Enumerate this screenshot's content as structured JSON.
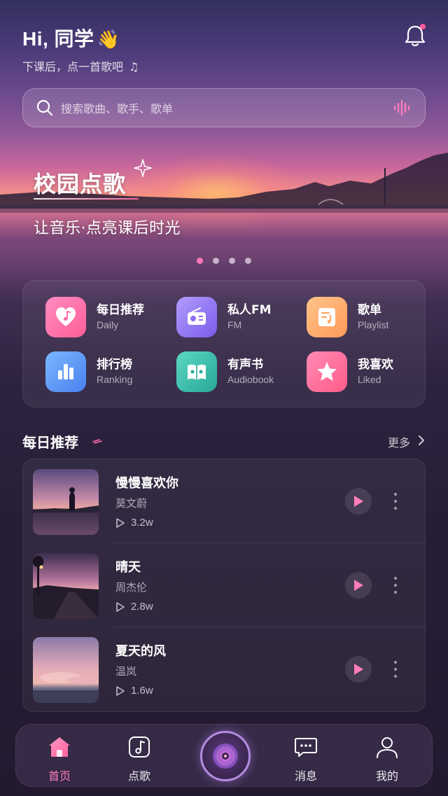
{
  "header": {
    "greeting": "Hi, 同学",
    "greeting_emoji": "👋",
    "subtitle": "下课后，点一首歌吧",
    "subtitle_icon": "music-note-icon"
  },
  "search": {
    "placeholder": "搜索歌曲、歌手、歌单"
  },
  "banner": {
    "title": "校园点歌",
    "subtitle": "让音乐·点亮课后时光",
    "active_slide": 1,
    "slide_count": 4
  },
  "quick_actions": [
    {
      "label": "每日推荐",
      "sub": "Daily",
      "icon": "heart-note-icon",
      "color": "#ff6fa8"
    },
    {
      "label": "私人FM",
      "sub": "FM",
      "icon": "radio-icon",
      "color": "#9a7cf5"
    },
    {
      "label": "歌单",
      "sub": "Playlist",
      "icon": "playlist-icon",
      "color": "#ffae6a"
    },
    {
      "label": "排行榜",
      "sub": "Ranking",
      "icon": "bar-chart-icon",
      "color": "#5a9cff"
    },
    {
      "label": "有声书",
      "sub": "Audiobook",
      "icon": "book-icon",
      "color": "#3ac4b0"
    },
    {
      "label": "我喜欢",
      "sub": "Liked",
      "icon": "star-icon",
      "color": "#ff6f98"
    }
  ],
  "daily": {
    "title": "每日推荐",
    "more": "更多",
    "songs": [
      {
        "title": "慢慢喜欢你",
        "artist": "莫文蔚",
        "plays": "3.2w"
      },
      {
        "title": "晴天",
        "artist": "周杰伦",
        "plays": "2.8w"
      },
      {
        "title": "夏天的风",
        "artist": "温岚",
        "plays": "1.6w"
      }
    ]
  },
  "nav": {
    "items": [
      {
        "label": "首页",
        "icon": "home-icon",
        "active": true
      },
      {
        "label": "点歌",
        "icon": "music-note-icon",
        "active": false
      },
      {
        "label": "",
        "icon": "vinyl-disc-icon",
        "active": false
      },
      {
        "label": "消息",
        "icon": "message-icon",
        "active": false
      },
      {
        "label": "我的",
        "icon": "user-icon",
        "active": false
      }
    ]
  },
  "colors": {
    "accent": "#ff78b6",
    "nav_active": "#ff7dbb"
  }
}
